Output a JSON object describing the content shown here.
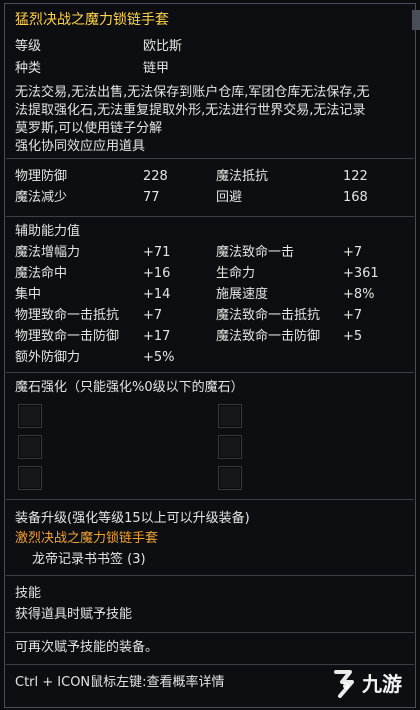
{
  "item": {
    "name": "猛烈决战之魔力锁链手套",
    "level_label": "等级",
    "level_value": "欧比斯",
    "type_label": "种类",
    "type_value": "链甲",
    "restrictions": [
      "无法交易,无法出售,无法保存到账户仓库,军团仓库无法保存,无",
      "法提取强化石,无法重复提取外形,无法进行世界交易,无法记录",
      "莫罗斯,可以使用链子分解"
    ],
    "synergy": "强化协同效应应用道具"
  },
  "base_stats": [
    {
      "label": "物理防御",
      "value": "228",
      "label2": "魔法抵抗",
      "value2": "122"
    },
    {
      "label": "魔法减少",
      "value": "77",
      "label2": "回避",
      "value2": "168"
    }
  ],
  "bonus": {
    "header": "辅助能力值",
    "rows": [
      {
        "label": "魔法增幅力",
        "value": "+71",
        "label2": "魔法致命一击",
        "value2": "+7"
      },
      {
        "label": "魔法命中",
        "value": "+16",
        "label2": "生命力",
        "value2": "+361"
      },
      {
        "label": "集中",
        "value": "+14",
        "label2": "施展速度",
        "value2": "+8%"
      },
      {
        "label": "物理致命一击抵抗",
        "value": "+7",
        "label2": "魔法致命一击抵抗",
        "value2": "+7"
      },
      {
        "label": "物理致命一击防御",
        "value": "+17",
        "label2": "魔法致命一击防御",
        "value2": "+5"
      },
      {
        "label": "额外防御力",
        "value": "+5%",
        "label2": "",
        "value2": ""
      }
    ]
  },
  "manastone": {
    "header": "魔石强化（只能强化%0级以下的魔石）"
  },
  "upgrade": {
    "header": "装备升级(强化等级15以上可以升级装备)",
    "target": "激烈决战之魔力锁链手套",
    "material": "龙帝记录书书签 (3)"
  },
  "skill": {
    "header": "技能",
    "desc": "获得道具时赋予技能"
  },
  "reskill": "可再次赋予技能的装备。",
  "hint": "Ctrl + ICON鼠标左键:查看概率详情",
  "watermark": "九游",
  "colors": {
    "title": "#ffd34a",
    "orange": "#f3a233",
    "text": "#e4e4e4",
    "lavender": "#b9a6ff"
  }
}
